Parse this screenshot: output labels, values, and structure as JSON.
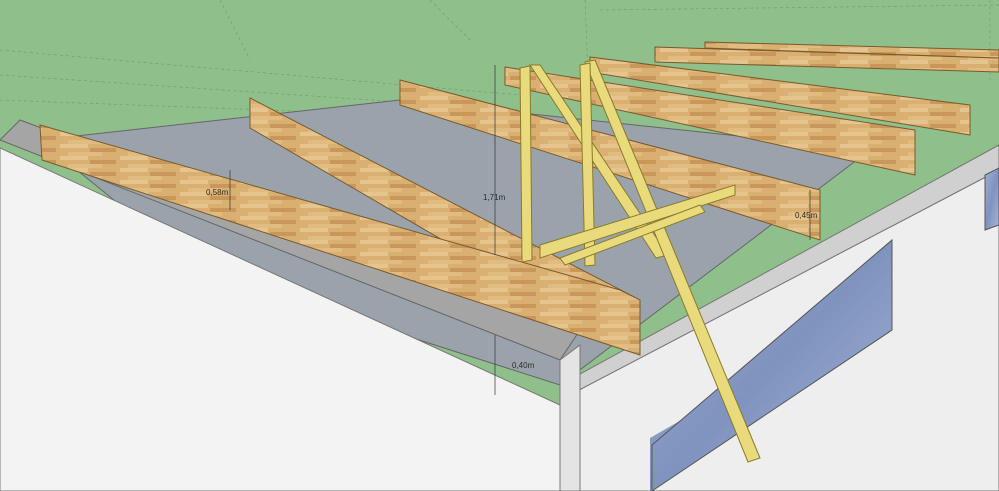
{
  "dimensions": [
    {
      "id": "beam-height",
      "label": "0,58m"
    },
    {
      "id": "frame-height",
      "label": "1,71m"
    },
    {
      "id": "wall-height",
      "label": "0,40m"
    },
    {
      "id": "rear-beam-height",
      "label": "0,45m"
    }
  ],
  "colors": {
    "ground": "#8fbf8a",
    "wall": "#f1f1f1",
    "wall_top": "#9e9e9e",
    "floor": "#9aa3ab",
    "wood": "#d9b071",
    "wood_dark": "#b88a4a",
    "frame": "#e9da7c",
    "window": "#8d9fc4"
  },
  "icons": [
    "scissor-frame",
    "roof-beam",
    "window-panel"
  ]
}
